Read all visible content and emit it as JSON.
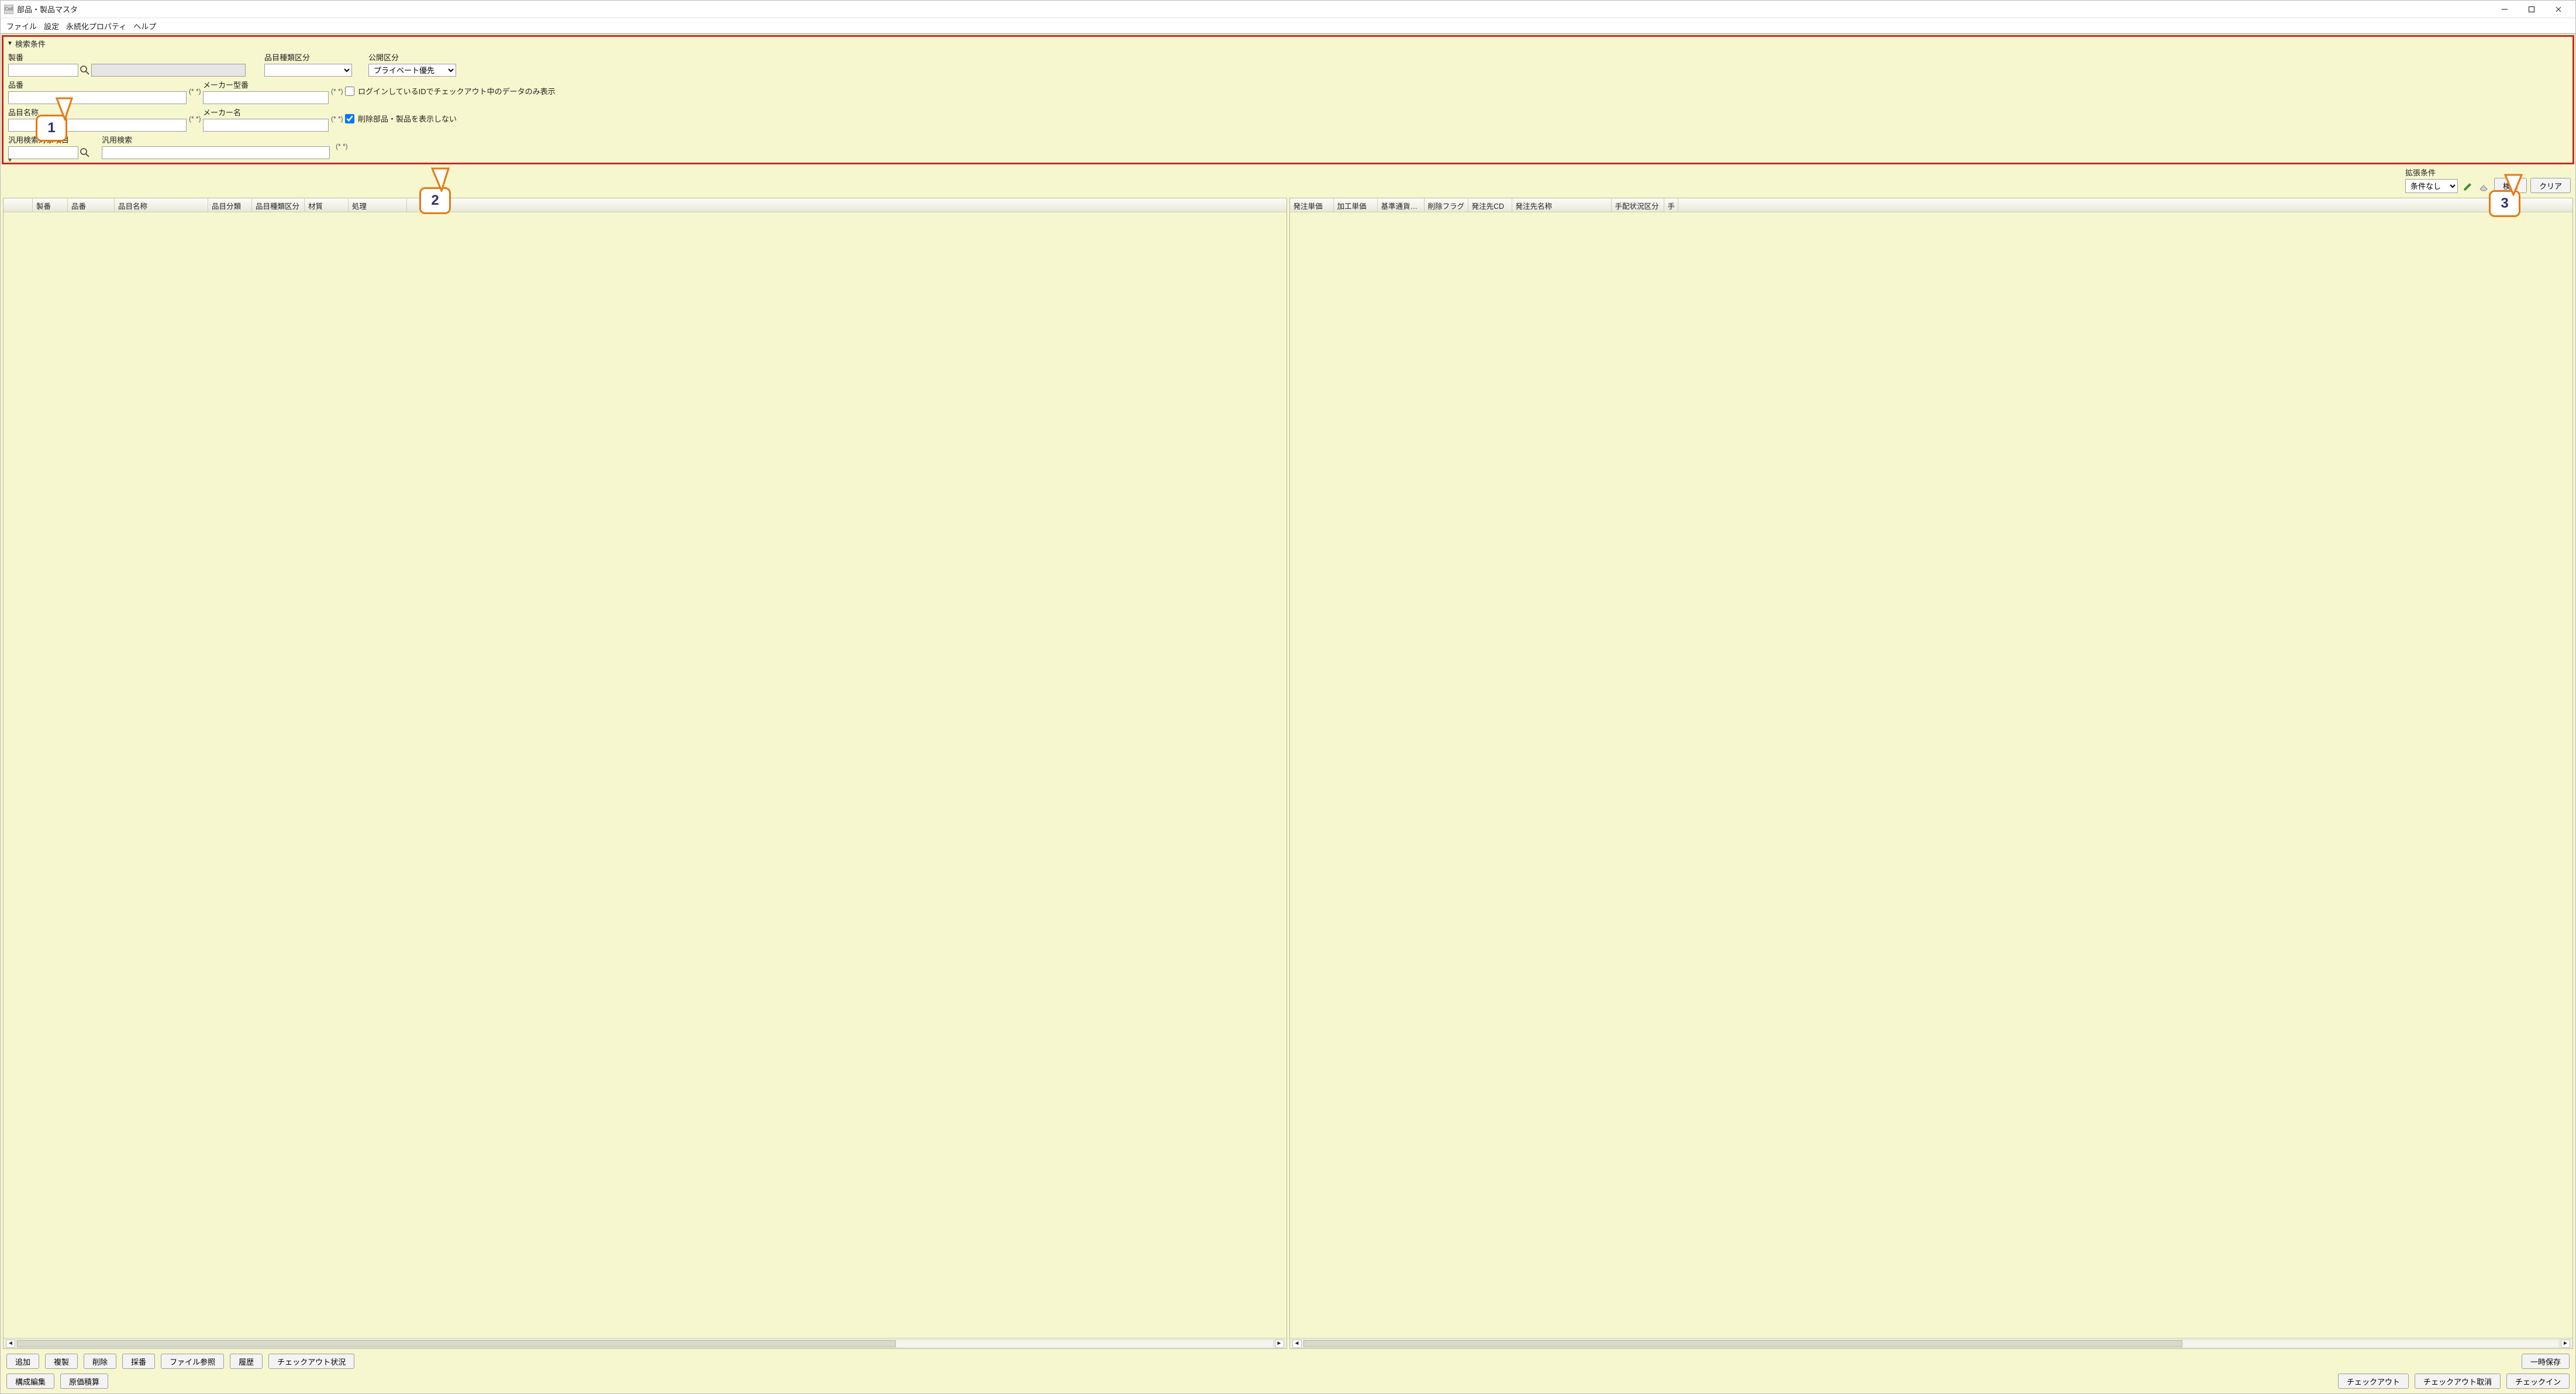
{
  "window": {
    "app_icon_text": "Cell",
    "title": "部品・製品マスタ"
  },
  "menu": {
    "file": "ファイル",
    "settings": "設定",
    "persist": "永続化プロパティ",
    "help": "ヘルプ"
  },
  "search": {
    "header": "検索条件",
    "seiban_label": "製番",
    "hinmoku_kubun_label": "品目種類区分",
    "koukai_kubun_label": "公開区分",
    "koukai_kubun_value": "プライベート優先",
    "hinban_label": "品番",
    "maker_model_label": "メーカー型番",
    "hinmoku_name_label": "品目名称",
    "maker_name_label": "メーカー名",
    "wildcard_hint": "(* *)",
    "chk_login_label": "ログインしているIDでチェックアウト中のデータのみ表示",
    "chk_hide_deleted_label": "削除部品・製品を表示しない",
    "generic_target_label": "汎用検索対象項目",
    "generic_search_label": "汎用検索"
  },
  "ext": {
    "label": "拡張条件",
    "value": "条件なし",
    "search_btn": "検索",
    "clear_btn": "クリア"
  },
  "columns_left": [
    "製番",
    "品番",
    "品目名称",
    "品目分類",
    "品目種類区分",
    "材質",
    "処理"
  ],
  "columns_right": [
    "発注単価",
    "加工単価",
    "基準通貨…",
    "削除フラグ",
    "発注先CD",
    "発注先名称",
    "手配状況区分",
    "手"
  ],
  "buttons": {
    "add": "追加",
    "copy": "複製",
    "delete": "削除",
    "saiban": "採番",
    "file_ref": "ファイル参照",
    "history": "履歴",
    "checkout_status": "チェックアウト状況",
    "temp_save": "一時保存",
    "kousei": "構成編集",
    "genka": "原価積算",
    "checkout": "チェックアウト",
    "checkout_cancel": "チェックアウト取消",
    "checkin": "チェックイン"
  },
  "callouts": {
    "c1": "1",
    "c2": "2",
    "c3": "3"
  }
}
